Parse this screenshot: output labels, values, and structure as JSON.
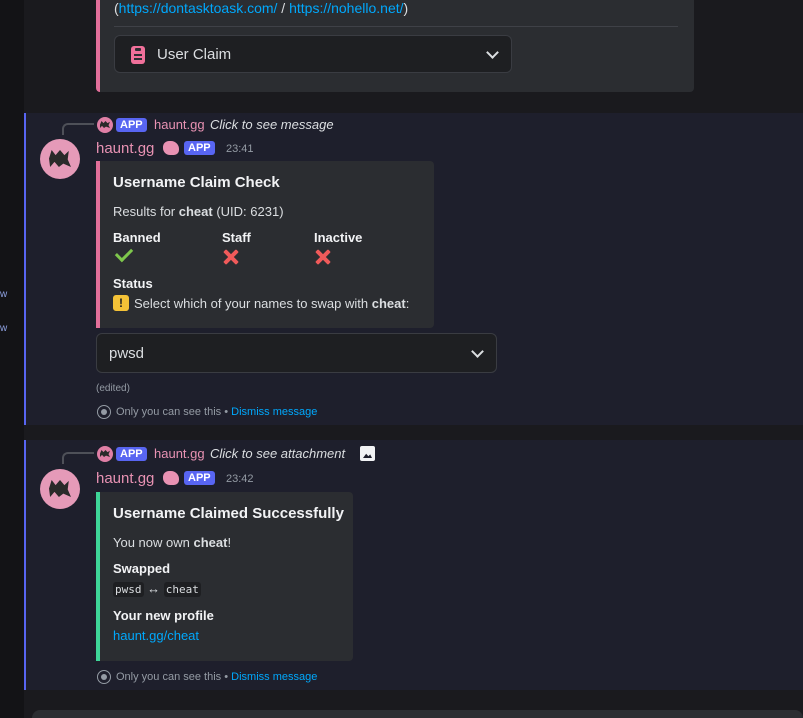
{
  "sidebar": {
    "frag1": "w",
    "frag2": "w"
  },
  "prev_message": {
    "links_open": "(",
    "link1": "https://dontasktoask.com/",
    "link_sep": " / ",
    "link2": "https://nohello.net/",
    "links_close": ")",
    "select_label": "User Claim"
  },
  "message1": {
    "reply": {
      "badge": "APP",
      "name": "haunt.gg",
      "text": "Click to see message"
    },
    "author": "haunt.gg",
    "badge": "APP",
    "time": "23:41",
    "embed": {
      "title": "Username Claim Check",
      "results_prefix": "Results for ",
      "results_name": "cheat",
      "results_suffix": " (UID: 6231)",
      "fields": [
        {
          "name": "Banned",
          "status": "check"
        },
        {
          "name": "Staff",
          "status": "cross"
        },
        {
          "name": "Inactive",
          "status": "cross"
        }
      ],
      "status_label": "Status",
      "status_icon": "!",
      "status_text": "Select which of your names to swap with ",
      "status_name": "cheat",
      "status_end": ":"
    },
    "select_value": "pwsd",
    "edited": "(edited)",
    "ephemeral_text": "Only you can see this • ",
    "dismiss": "Dismiss message"
  },
  "message2": {
    "reply": {
      "badge": "APP",
      "name": "haunt.gg",
      "text": "Click to see attachment"
    },
    "author": "haunt.gg",
    "badge": "APP",
    "time": "23:42",
    "embed": {
      "title": "Username Claimed Successfully",
      "own_prefix": "You now own ",
      "own_name": "cheat",
      "own_suffix": "!",
      "swapped_label": "Swapped",
      "swap_from": "pwsd",
      "swap_arrow": " ↔ ",
      "swap_to": "cheat",
      "profile_label": "Your new profile",
      "profile_link": "haunt.gg/cheat"
    },
    "ephemeral_text": "Only you can see this • ",
    "dismiss": "Dismiss message"
  },
  "colors": {
    "accent_pink": "#e26f9a",
    "accent_green": "#3ed598",
    "brand": "#5865f2",
    "link": "#00a8fc"
  }
}
